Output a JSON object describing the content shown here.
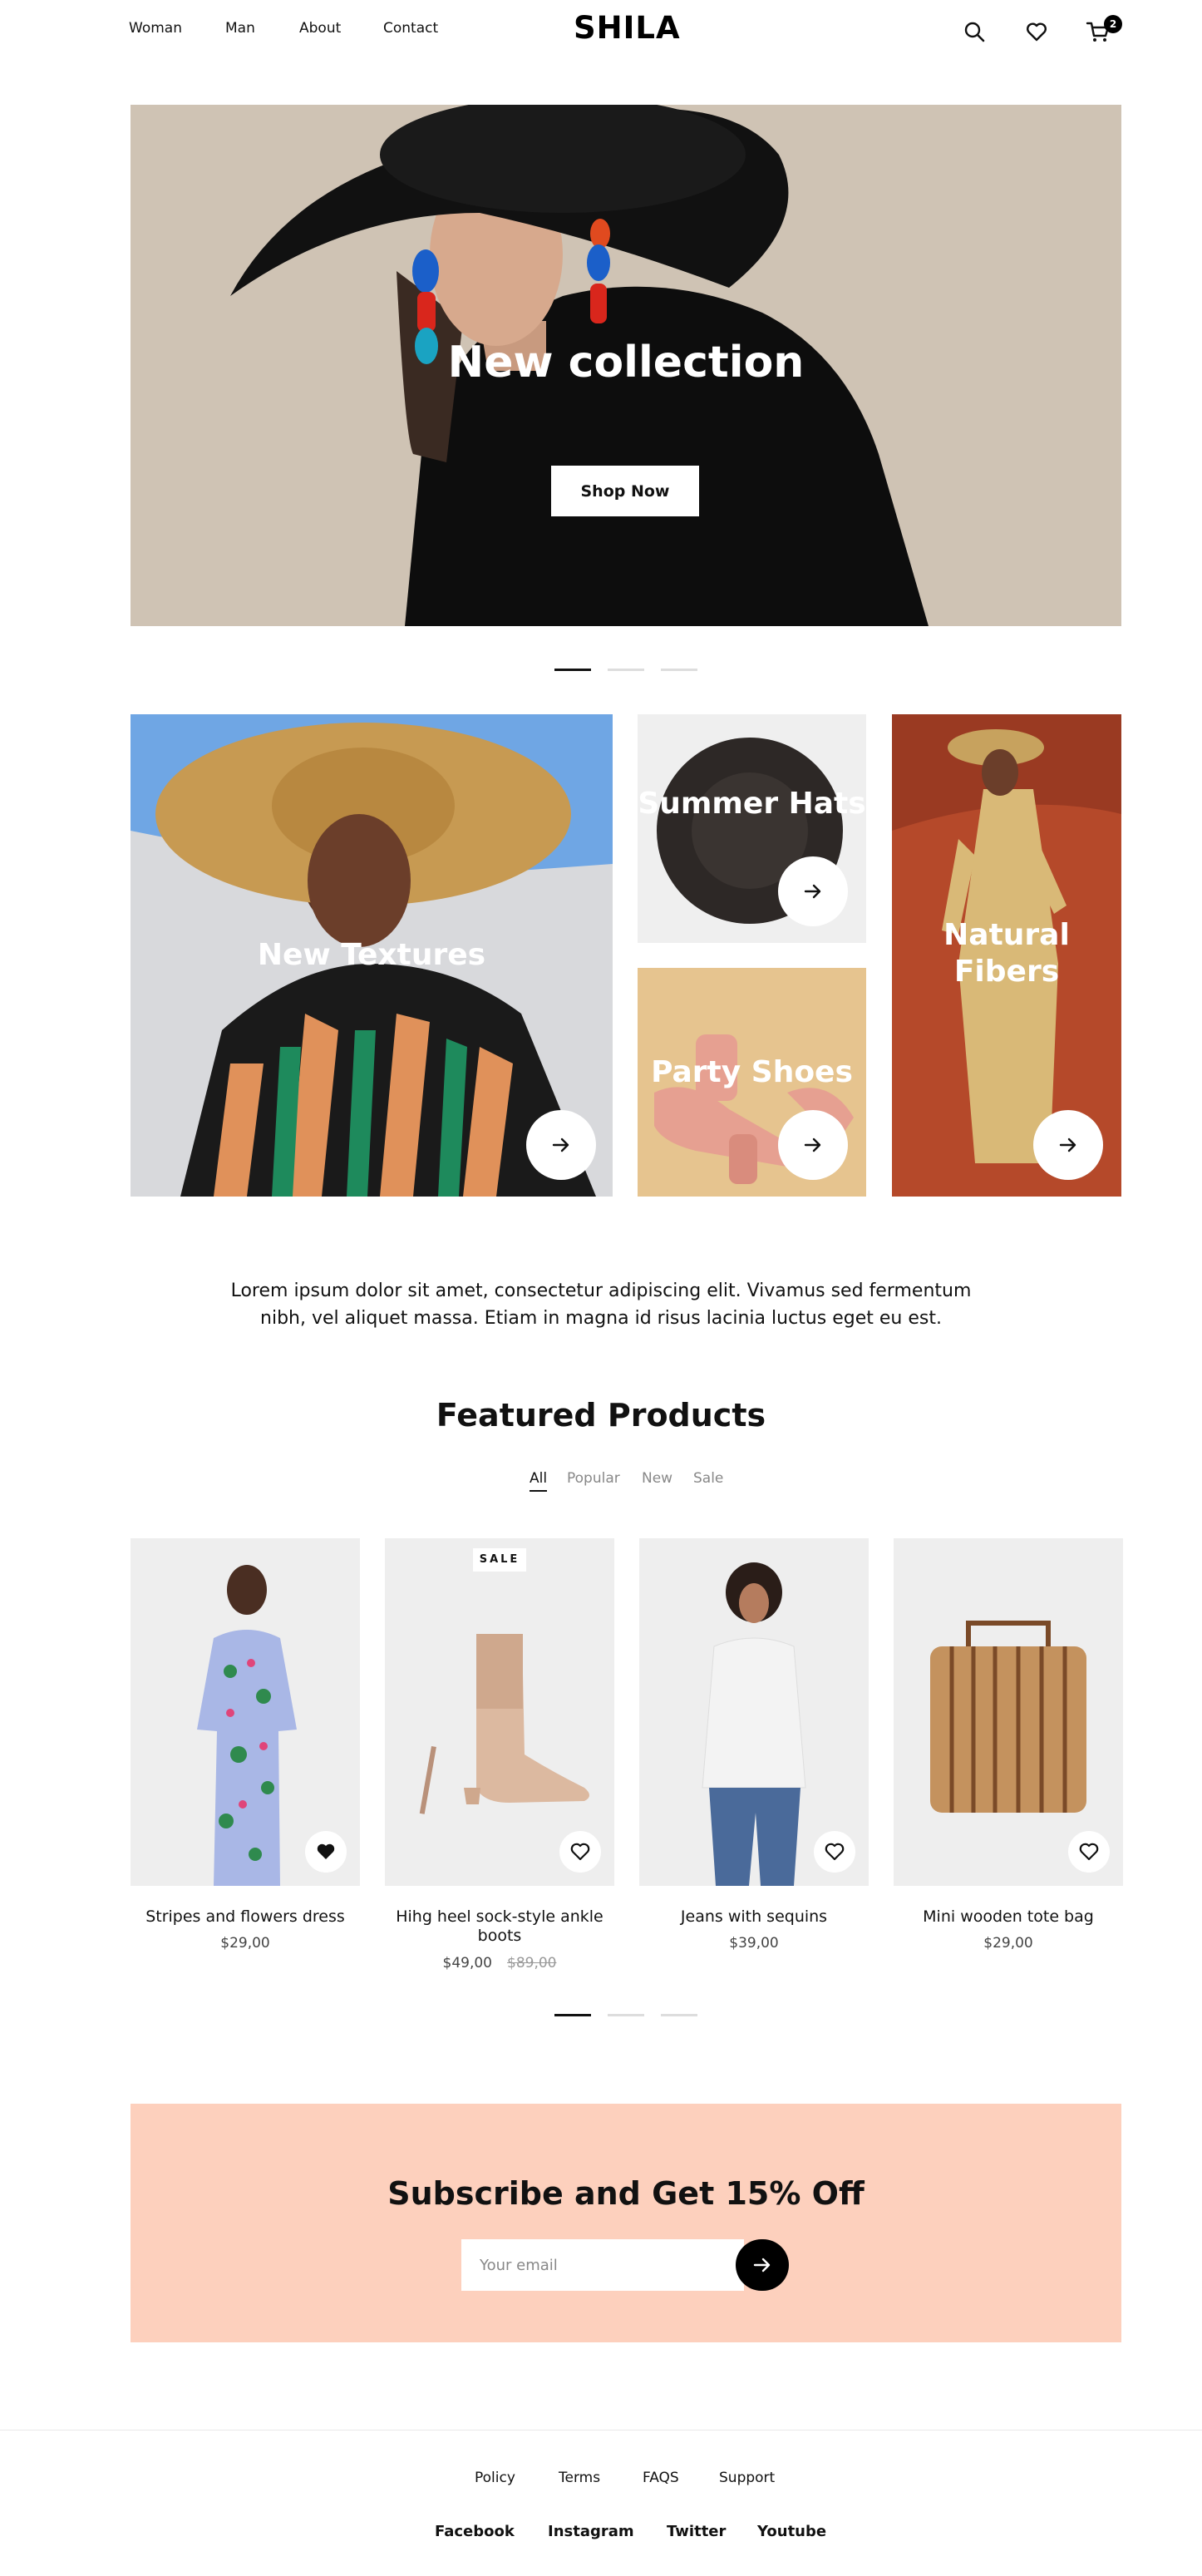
{
  "header": {
    "nav": [
      "Woman",
      "Man",
      "About",
      "Contact"
    ],
    "logo": "SHILA",
    "cart_count": "2",
    "icons": [
      "search-icon",
      "heart-icon",
      "cart-icon"
    ]
  },
  "hero": {
    "title": "New collection",
    "button_label": "Shop Now",
    "slides": 3,
    "active_slide": 1
  },
  "categories": [
    {
      "title": "New Textures"
    },
    {
      "title": "Summer Hats"
    },
    {
      "title": "Party Shoes"
    },
    {
      "title": "Natural Fibers"
    }
  ],
  "intro_text": "Lorem ipsum dolor sit amet, consectetur adipiscing elit. Vivamus sed fermentum nibh, vel aliquet massa. Etiam in magna id risus lacinia luctus eget eu est.",
  "featured": {
    "title": "Featured Products",
    "tabs": [
      "All",
      "Popular",
      "New",
      "Sale"
    ],
    "active_tab": "All",
    "products": [
      {
        "name": "Stripes and flowers dress",
        "price": "$29,00",
        "old_price": "",
        "badge": "",
        "favorited": true
      },
      {
        "name": "Hihg heel sock-style ankle boots",
        "price": "$49,00",
        "old_price": "$89,00",
        "badge": "SALE",
        "favorited": false
      },
      {
        "name": "Jeans with sequins",
        "price": "$39,00",
        "old_price": "",
        "badge": "",
        "favorited": false
      },
      {
        "name": "Mini wooden tote bag",
        "price": "$29,00",
        "old_price": "",
        "badge": "",
        "favorited": false
      }
    ]
  },
  "subscribe": {
    "title": "Subscribe and Get 15% Off",
    "placeholder": "Your email"
  },
  "footer": {
    "links": [
      "Policy",
      "Terms",
      "FAQS",
      "Support"
    ],
    "social": [
      "Facebook",
      "Instagram",
      "Twitter",
      "Youtube"
    ]
  },
  "colors": {
    "accent": "#000000",
    "subscribe_bg": "#fdd0bd",
    "hero_bg": "#cfc3b4"
  }
}
